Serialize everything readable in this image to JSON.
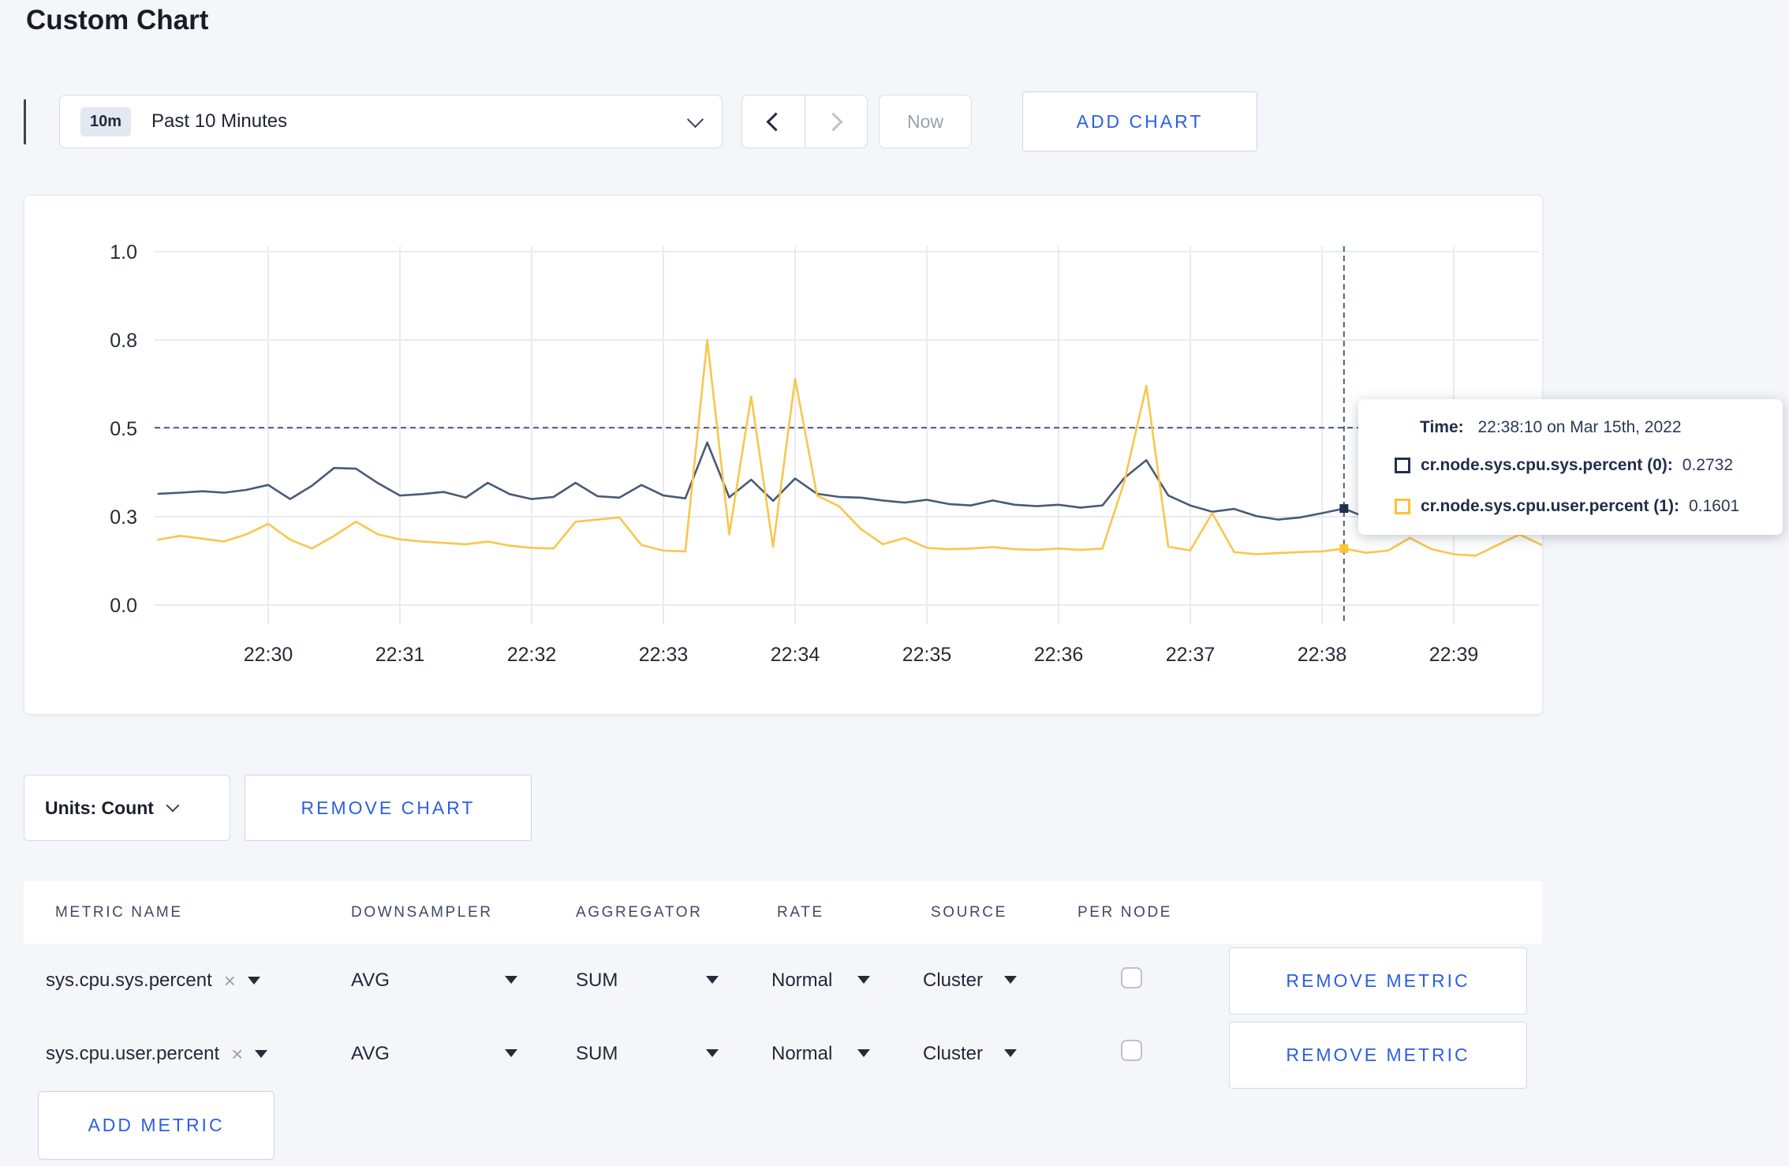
{
  "page": {
    "title": "Custom Chart"
  },
  "toolbar": {
    "time_badge": "10m",
    "time_label": "Past 10 Minutes",
    "now_label": "Now",
    "add_chart_label": "ADD CHART"
  },
  "chart_data": {
    "type": "line",
    "title": "",
    "xlabel": "",
    "ylabel": "",
    "ylim": [
      0,
      1
    ],
    "grid": true,
    "y_tick_values": [
      0,
      0.25,
      0.5,
      0.75,
      1.0
    ],
    "y_tick_labels": [
      "0.0",
      "0.3",
      "0.5",
      "0.8",
      "1.0"
    ],
    "x_tick_labels": [
      "22:30",
      "22:31",
      "22:32",
      "22:33",
      "22:34",
      "22:35",
      "22:36",
      "22:37",
      "22:38",
      "22:39"
    ],
    "x_start": "22:29:10",
    "x_step_seconds": 10,
    "x_times": [
      "22:29:10",
      "22:29:20",
      "22:29:30",
      "22:29:40",
      "22:29:50",
      "22:30:00",
      "22:30:10",
      "22:30:20",
      "22:30:30",
      "22:30:40",
      "22:30:50",
      "22:31:00",
      "22:31:10",
      "22:31:20",
      "22:31:30",
      "22:31:40",
      "22:31:50",
      "22:32:00",
      "22:32:10",
      "22:32:20",
      "22:32:30",
      "22:32:40",
      "22:32:50",
      "22:33:00",
      "22:33:10",
      "22:33:20",
      "22:33:30",
      "22:33:40",
      "22:33:50",
      "22:34:00",
      "22:34:10",
      "22:34:20",
      "22:34:30",
      "22:34:40",
      "22:34:50",
      "22:35:00",
      "22:35:10",
      "22:35:20",
      "22:35:30",
      "22:35:40",
      "22:35:50",
      "22:36:00",
      "22:36:10",
      "22:36:20",
      "22:36:30",
      "22:36:40",
      "22:36:50",
      "22:37:00",
      "22:37:10",
      "22:37:20",
      "22:37:30",
      "22:37:40",
      "22:37:50",
      "22:38:00",
      "22:38:10",
      "22:38:20",
      "22:38:30",
      "22:38:40",
      "22:38:50",
      "22:39:00",
      "22:39:10",
      "22:39:20",
      "22:39:30",
      "22:39:40"
    ],
    "series": [
      {
        "name": "cr.node.sys.cpu.sys.percent",
        "color": "#4a5a76",
        "marker_color": "#22304f",
        "values": [
          0.315,
          0.318,
          0.322,
          0.318,
          0.326,
          0.34,
          0.3,
          0.338,
          0.388,
          0.386,
          0.345,
          0.31,
          0.314,
          0.32,
          0.304,
          0.346,
          0.314,
          0.3,
          0.306,
          0.346,
          0.308,
          0.304,
          0.34,
          0.31,
          0.302,
          0.46,
          0.305,
          0.355,
          0.295,
          0.358,
          0.315,
          0.306,
          0.304,
          0.296,
          0.29,
          0.298,
          0.286,
          0.282,
          0.296,
          0.284,
          0.28,
          0.284,
          0.276,
          0.282,
          0.36,
          0.41,
          0.31,
          0.282,
          0.264,
          0.272,
          0.252,
          0.242,
          0.248,
          0.26,
          0.2732,
          0.248,
          0.258,
          0.264,
          0.258,
          0.274,
          0.288,
          0.298,
          0.304,
          0.296
        ]
      },
      {
        "name": "cr.node.sys.cpu.user.percent",
        "color": "#f9c64d",
        "marker_color": "#fdc334",
        "values": [
          0.185,
          0.196,
          0.188,
          0.18,
          0.2,
          0.23,
          0.185,
          0.16,
          0.196,
          0.236,
          0.2,
          0.186,
          0.18,
          0.176,
          0.172,
          0.18,
          0.168,
          0.162,
          0.16,
          0.236,
          0.242,
          0.248,
          0.17,
          0.154,
          0.152,
          0.75,
          0.2,
          0.59,
          0.165,
          0.64,
          0.31,
          0.28,
          0.215,
          0.172,
          0.19,
          0.162,
          0.158,
          0.16,
          0.164,
          0.158,
          0.156,
          0.16,
          0.156,
          0.16,
          0.35,
          0.62,
          0.165,
          0.155,
          0.26,
          0.15,
          0.144,
          0.147,
          0.15,
          0.152,
          0.1601,
          0.148,
          0.154,
          0.19,
          0.158,
          0.144,
          0.14,
          0.17,
          0.2,
          0.17
        ]
      }
    ],
    "crosshair": {
      "index": 54,
      "time": "22:38:10",
      "y_value": 0.502
    },
    "colors": {
      "gridline": "#e9ebf0",
      "axis_text": "#242c38",
      "crosshair": "#4c5f7d"
    }
  },
  "tooltip": {
    "time_label": "Time:",
    "time_value": "22:38:10 on Mar 15th, 2022",
    "rows": [
      {
        "name": "cr.node.sys.cpu.sys.percent (0):",
        "value": "0.2732",
        "color": "#22304f"
      },
      {
        "name": "cr.node.sys.cpu.user.percent (1):",
        "value": "0.1601",
        "color": "#fdc334"
      }
    ]
  },
  "chart_footer": {
    "units_label": "Units: Count",
    "remove_chart_label": "REMOVE CHART"
  },
  "metrics_table": {
    "headers": [
      "METRIC NAME",
      "DOWNSAMPLER",
      "AGGREGATOR",
      "RATE",
      "SOURCE",
      "PER NODE"
    ],
    "remove_x": "×",
    "rows": [
      {
        "metric": "sys.cpu.sys.percent",
        "downsampler": "AVG",
        "aggregator": "SUM",
        "rate": "Normal",
        "source": "Cluster",
        "per_node": false,
        "remove_label": "REMOVE METRIC"
      },
      {
        "metric": "sys.cpu.user.percent",
        "downsampler": "AVG",
        "aggregator": "SUM",
        "rate": "Normal",
        "source": "Cluster",
        "per_node": false,
        "remove_label": "REMOVE METRIC"
      }
    ],
    "add_metric_label": "ADD METRIC"
  }
}
